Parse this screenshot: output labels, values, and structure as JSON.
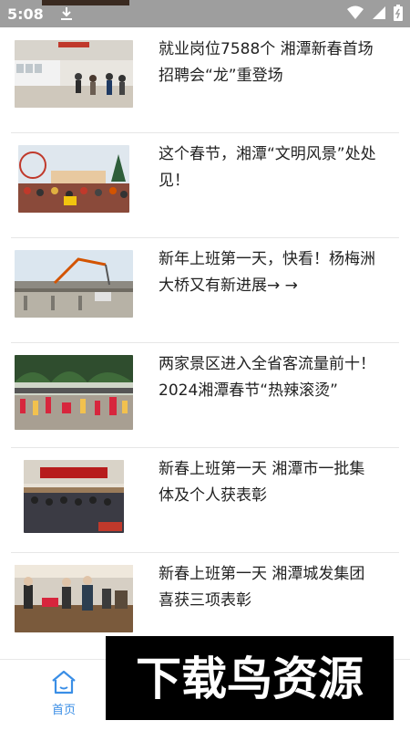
{
  "status_bar": {
    "time": "5:08"
  },
  "news": [
    {
      "title": "就业岗位7588个 湘潭新春首场招聘会“龙”重登场",
      "image": "job-fair-hall-photo"
    },
    {
      "title": "这个春节，湘潭“文明风景”处处见！",
      "image": "spring-festival-crowd-photo"
    },
    {
      "title": "新年上班第一天，快看！杨梅洲大桥又有新进展→ →",
      "image": "bridge-construction-photo"
    },
    {
      "title": "两家景区进入全省客流量前十！2024湘潭春节“热辣滚烫”",
      "image": "lion-dance-performance-photo"
    },
    {
      "title": "新春上班第一天 湘潭市一批集体及个人获表彰",
      "image": "award-meeting-photo"
    },
    {
      "title": "新春上班第一天 湘潭城发集团喜获三项表彰",
      "image": "award-presentation-photo"
    }
  ],
  "tab_bar": {
    "home_label": "首页"
  },
  "watermark": {
    "text": "下载鸟资源"
  },
  "colors": {
    "accent": "#3a8ee6",
    "status_bar": "#9e9e9e"
  }
}
